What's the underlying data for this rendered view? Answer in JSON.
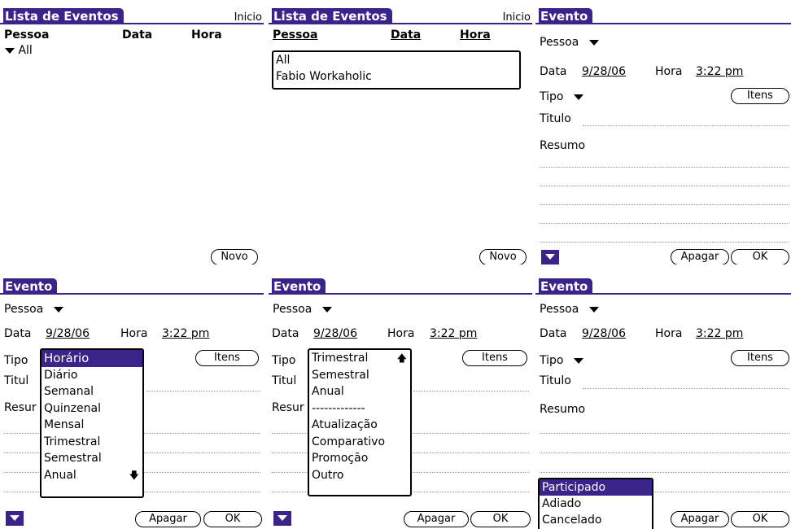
{
  "list_title": "Lista de Eventos",
  "inicio": "Inicio",
  "col_pessoa": "Pessoa",
  "col_data": "Data",
  "col_hora": "Hora",
  "all": "All",
  "person_options": [
    "All",
    "Fabio Workaholic"
  ],
  "novo": "Novo",
  "event_title": "Evento",
  "pessoa": "Pessoa",
  "data_label": "Data",
  "data_value": "9/28/06",
  "hora_label": "Hora",
  "hora_value": "3:22 pm",
  "tipo": "Tipo",
  "itens": "Itens",
  "titulo": "Titulo",
  "titulo_cut": "Titul",
  "resumo": "Resumo",
  "resumo_cut": "Resur",
  "apagar": "Apagar",
  "ok": "OK",
  "tipo_options_top": [
    "Horário",
    "Diário",
    "Semanal",
    "Quinzenal",
    "Mensal",
    "Trimestral",
    "Semestral",
    "Anual"
  ],
  "tipo_options_bottom": [
    "Trimestral",
    "Semestral",
    "Anual",
    "-------------",
    "Atualização",
    "Comparativo",
    "Promoção",
    "Outro"
  ],
  "status_options": [
    "Participado",
    "Adiado",
    "Cancelado"
  ],
  "arrow_up": "🡅",
  "arrow_down": "🡇"
}
